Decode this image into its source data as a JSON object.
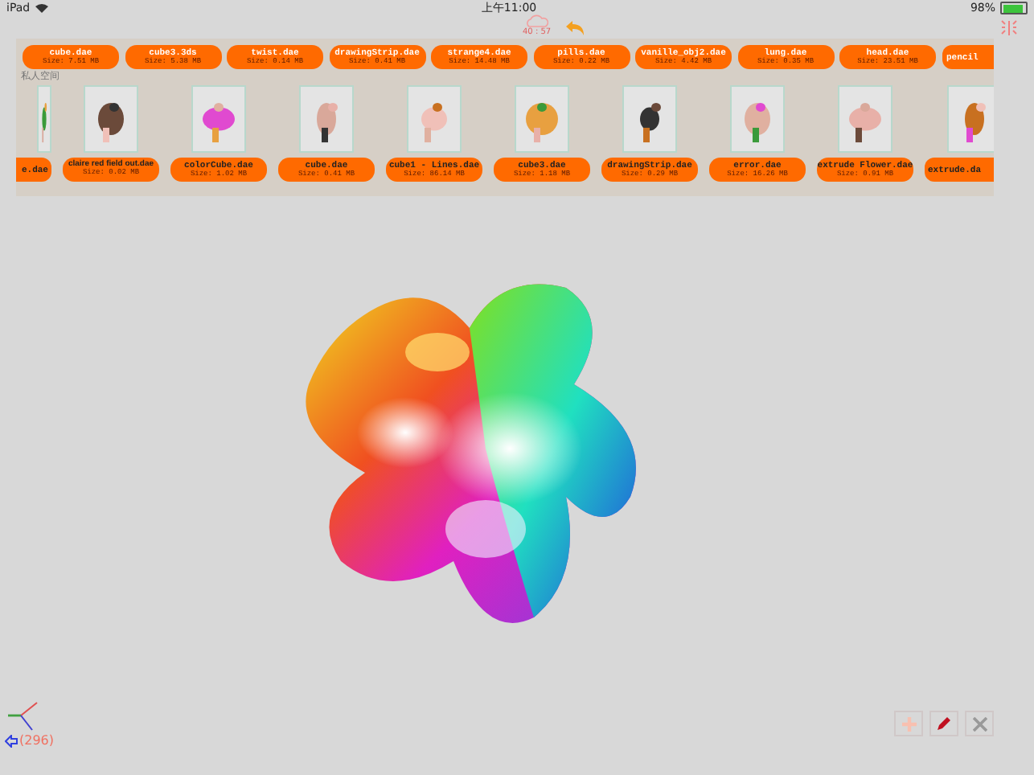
{
  "status_bar": {
    "device": "iPad",
    "time": "上午11:00",
    "battery": "98%"
  },
  "toolbar": {
    "cloud_caption": "40 : 57"
  },
  "models_top": [
    {
      "name": "cube.dae",
      "size": "Size: 7.51 MB"
    },
    {
      "name": "cube3.3ds",
      "size": "Size: 5.38 MB"
    },
    {
      "name": "twist.dae",
      "size": "Size: 0.14 MB"
    },
    {
      "name": "drawingStrip.dae",
      "size": "Size: 0.41 MB"
    },
    {
      "name": "strange4.dae",
      "size": "Size: 14.48 MB"
    },
    {
      "name": "pills.dae",
      "size": "Size: 0.22 MB"
    },
    {
      "name": "vanille_obj2.dae",
      "size": "Size: 4.42 MB"
    },
    {
      "name": "lung.dae",
      "size": "Size: 0.35 MB"
    },
    {
      "name": "head.dae",
      "size": "Size: 23.51 MB"
    },
    {
      "name": "pencil"
    }
  ],
  "section_label": "私人空间",
  "models_private": [
    {
      "name": "e.dae"
    },
    {
      "name": "claire red field out.dae",
      "size": "Size: 0.02 MB"
    },
    {
      "name": "colorCube.dae",
      "size": "Size: 1.02 MB"
    },
    {
      "name": "cube.dae",
      "size": "Size: 0.41 MB"
    },
    {
      "name": "cube1 - Lines.dae",
      "size": "Size: 86.14 MB"
    },
    {
      "name": "cube3.dae",
      "size": "Size: 1.18 MB"
    },
    {
      "name": "drawingStrip.dae",
      "size": "Size: 0.29 MB"
    },
    {
      "name": "error.dae",
      "size": "Size: 16.26 MB"
    },
    {
      "name": "extrude Flower.dae",
      "size": "Size: 0.91 MB"
    },
    {
      "name": "extrude.da"
    }
  ],
  "footer": {
    "count": "(296)"
  }
}
